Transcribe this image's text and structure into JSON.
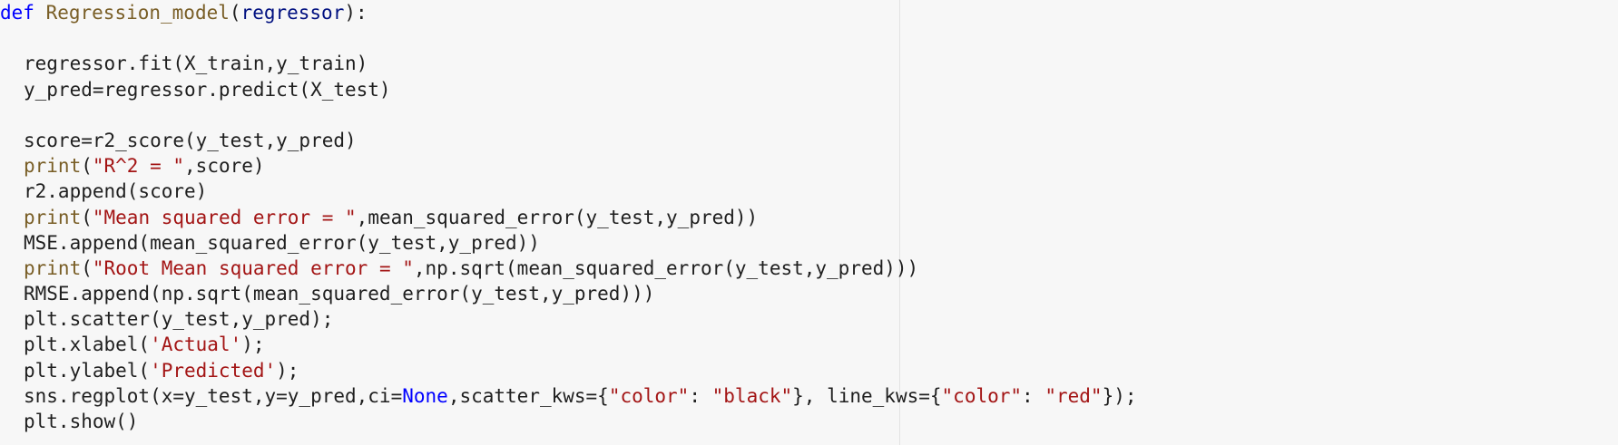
{
  "theme": {
    "background": "#f7f7f7",
    "text": "#1f1f1f",
    "keyword": "#0000ff",
    "function": "#795e26",
    "parameter": "#001080",
    "string": "#a31515"
  },
  "code": {
    "l01": {
      "kw": "def",
      "sp": " ",
      "fn": "Regression_model",
      "open": "(",
      "param": "regressor",
      "close": "):"
    },
    "l03": "regressor.fit(X_train,y_train)",
    "l04": "y_pred=regressor.predict(X_test)",
    "l06": "score=r2_score(y_test,y_pred)",
    "l07": {
      "fn": "print",
      "open": "(",
      "str": "\"R^2 = \"",
      "rest": ",score)"
    },
    "l08": "r2.append(score)",
    "l09": {
      "fn": "print",
      "open": "(",
      "str": "\"Mean squared error = \"",
      "rest": ",mean_squared_error(y_test,y_pred))"
    },
    "l10": "MSE.append(mean_squared_error(y_test,y_pred))",
    "l11": {
      "fn": "print",
      "open": "(",
      "str": "\"Root Mean squared error = \"",
      "rest": ",np.sqrt(mean_squared_error(y_test,y_pred)))"
    },
    "l12": "RMSE.append(np.sqrt(mean_squared_error(y_test,y_pred)))",
    "l13": "plt.scatter(y_test,y_pred);",
    "l14": {
      "a": "plt.xlabel(",
      "str": "'Actual'",
      "b": ");"
    },
    "l15": {
      "a": "plt.ylabel(",
      "str": "'Predicted'",
      "b": ");"
    },
    "l16": {
      "a": "sns.regplot(x=y_test,y=y_pred,ci=",
      "const": "None",
      "b": ",scatter_kws={",
      "s1": "\"color\"",
      "c1": ": ",
      "s2": "\"black\"",
      "c2": "}, line_kws={",
      "s3": "\"color\"",
      "c3": ": ",
      "s4": "\"red\"",
      "c4": "});"
    },
    "l17": "plt.show()"
  }
}
